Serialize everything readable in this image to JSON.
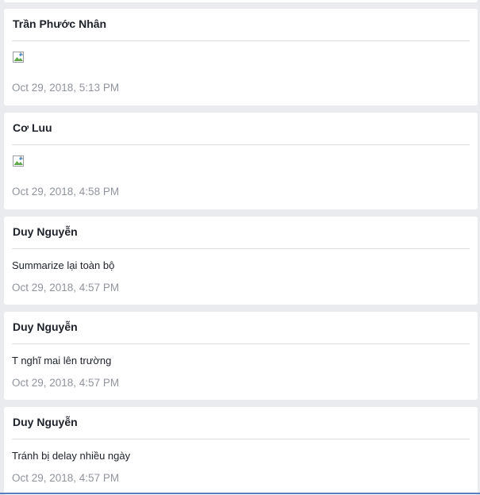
{
  "messages": [
    {
      "author": "Trần Phước Nhân",
      "type": "image",
      "time": "Oct 29, 2018, 5:13 PM"
    },
    {
      "author": "Cơ Luu",
      "type": "image",
      "time": "Oct 29, 2018, 4:58 PM"
    },
    {
      "author": "Duy Nguyễn",
      "type": "text",
      "text": "Summarize lại toàn bộ",
      "time": "Oct 29, 2018, 4:57 PM"
    },
    {
      "author": "Duy Nguyễn",
      "type": "text",
      "text": "T nghĩ mai lên trường",
      "time": "Oct 29, 2018, 4:57 PM"
    },
    {
      "author": "Duy Nguyễn",
      "type": "text",
      "text": "Tránh bị delay nhiều ngày",
      "time": "Oct 29, 2018, 4:57 PM"
    }
  ]
}
